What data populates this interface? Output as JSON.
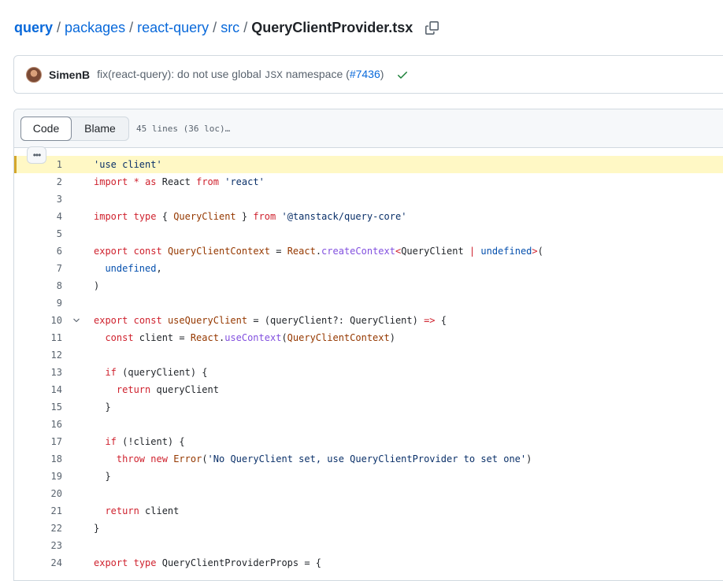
{
  "breadcrumb": {
    "items": [
      "query",
      "packages",
      "react-query",
      "src"
    ],
    "separator": "/",
    "current": "QueryClientProvider.tsx"
  },
  "commit": {
    "author": "SimenB",
    "message_prefix": "fix(react-query): do not use global ",
    "message_code": "JSX",
    "message_suffix": " namespace (",
    "pr": "#7436",
    "message_end": ")",
    "status": "success"
  },
  "file_header": {
    "tabs": [
      "Code",
      "Blame"
    ],
    "active_tab": "Code",
    "lines_info": "45 lines (36 loc)…"
  },
  "code": [
    {
      "n": "1",
      "text": "'use client'"
    },
    {
      "n": "2",
      "text": "import * as React from 'react'"
    },
    {
      "n": "3",
      "text": ""
    },
    {
      "n": "4",
      "text": "import type { QueryClient } from '@tanstack/query-core'"
    },
    {
      "n": "5",
      "text": ""
    },
    {
      "n": "6",
      "text": "export const QueryClientContext = React.createContext<QueryClient | undefined>("
    },
    {
      "n": "7",
      "text": "  undefined,"
    },
    {
      "n": "8",
      "text": ")"
    },
    {
      "n": "9",
      "text": ""
    },
    {
      "n": "10",
      "text": "export const useQueryClient = (queryClient?: QueryClient) => {"
    },
    {
      "n": "11",
      "text": "  const client = React.useContext(QueryClientContext)"
    },
    {
      "n": "12",
      "text": ""
    },
    {
      "n": "13",
      "text": "  if (queryClient) {"
    },
    {
      "n": "14",
      "text": "    return queryClient"
    },
    {
      "n": "15",
      "text": "  }"
    },
    {
      "n": "16",
      "text": ""
    },
    {
      "n": "17",
      "text": "  if (!client) {"
    },
    {
      "n": "18",
      "text": "    throw new Error('No QueryClient set, use QueryClientProvider to set one')"
    },
    {
      "n": "19",
      "text": "  }"
    },
    {
      "n": "20",
      "text": ""
    },
    {
      "n": "21",
      "text": "  return client"
    },
    {
      "n": "22",
      "text": "}"
    },
    {
      "n": "23",
      "text": ""
    },
    {
      "n": "24",
      "text": "export type QueryClientProviderProps = {"
    }
  ],
  "colors": {
    "link": "#0969da",
    "keyword": "#cf222e",
    "string": "#0a3069",
    "function": "#8250df",
    "type": "#953800",
    "constant": "#0550ae",
    "highlight": "#fff8c5",
    "success": "#1a7f37"
  },
  "icons": {
    "copy": "copy-icon",
    "check": "check-icon",
    "fold": "chevron-down-icon",
    "kebab": "kebab-horizontal-icon"
  }
}
